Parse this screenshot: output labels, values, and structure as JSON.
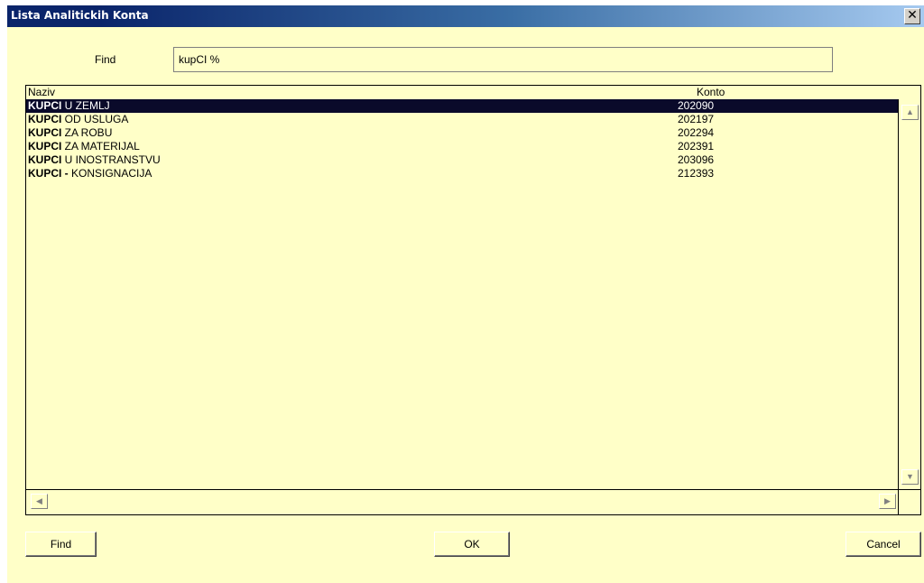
{
  "window": {
    "title": "Lista Analitickih Konta",
    "close_glyph": "✕"
  },
  "search": {
    "label": "Find",
    "value": "kupCI %"
  },
  "table": {
    "columns": [
      "Naziv",
      "Konto"
    ],
    "rows": [
      {
        "bold": "KUPCI",
        "rest": " U ZEMLJ",
        "konto": "202090",
        "selected": true
      },
      {
        "bold": "KUPCI",
        "rest": " OD USLUGA",
        "konto": "202197",
        "selected": false
      },
      {
        "bold": "KUPCI",
        "rest": " ZA ROBU",
        "konto": "202294",
        "selected": false
      },
      {
        "bold": "KUPCI",
        "rest": " ZA MATERIJAL",
        "konto": "202391",
        "selected": false
      },
      {
        "bold": "KUPCI",
        "rest": " U INOSTRANSTVU",
        "konto": "203096",
        "selected": false
      },
      {
        "bold": "KUPCI -",
        "rest": " KONSIGNACIJA",
        "konto": "212393",
        "selected": false
      }
    ]
  },
  "scrollbars": {
    "up_icon": "▲",
    "down_icon": "▼",
    "left_icon": "◀",
    "right_icon": "▶"
  },
  "buttons": {
    "find_label": "Find",
    "ok_label": "OK",
    "cancel_label": "Cancel"
  },
  "colors": {
    "background": "#ffffc8",
    "title_bar": "#0a246a",
    "selection": "#0a0a2a"
  }
}
